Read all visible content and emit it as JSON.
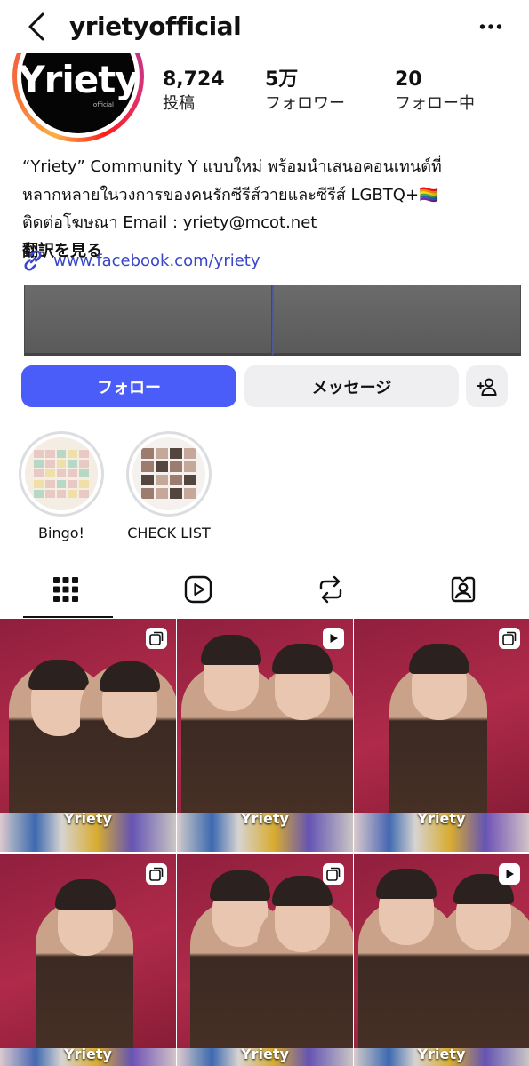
{
  "header": {
    "username": "yrietyofficial",
    "back_icon": "chevron-left-icon",
    "more_icon": "more-horizontal-icon"
  },
  "profile": {
    "avatar_text": "Yriety",
    "avatar_sub": "official",
    "stats": [
      {
        "value": "8,724",
        "label": "投稿"
      },
      {
        "value": "5万",
        "label": "フォロワー"
      },
      {
        "value": "20",
        "label": "フォロー中"
      }
    ],
    "bio_lines": [
      "“Yriety” Community Y แบบใหม่ พร้อมนำเสนอคอนเทนต์ที่",
      "หลากหลายในวงการของคนรักซีรีส์วายและซีรีส์ LGBTQ+🏳️‍🌈",
      "ติดต่อโฆษณา Email : yriety@mcot.net"
    ],
    "translate_label": "翻訳を見る",
    "link": "www.facebook.com/yriety"
  },
  "actions": {
    "follow_label": "フォロー",
    "message_label": "メッセージ",
    "suggest_icon": "add-person-icon"
  },
  "colors": {
    "accent": "#4a5df9",
    "link": "#3a46c9",
    "button_bg": "#efeff1"
  },
  "highlights": [
    {
      "label": "Bingo!"
    },
    {
      "label": "CHECK LIST"
    }
  ],
  "tabs": [
    {
      "name": "grid",
      "icon": "grid-icon",
      "active": true
    },
    {
      "name": "reels",
      "icon": "reels-icon",
      "active": false
    },
    {
      "name": "reposts",
      "icon": "repost-icon",
      "active": false
    },
    {
      "name": "tagged",
      "icon": "tagged-icon",
      "active": false
    }
  ],
  "posts": [
    {
      "type": "carousel",
      "brand": "Yriety"
    },
    {
      "type": "reel",
      "brand": "Yriety"
    },
    {
      "type": "carousel",
      "brand": "Yriety"
    },
    {
      "type": "carousel",
      "brand": "Yriety"
    },
    {
      "type": "carousel",
      "brand": "Yriety"
    },
    {
      "type": "reel",
      "brand": "Yriety"
    }
  ]
}
